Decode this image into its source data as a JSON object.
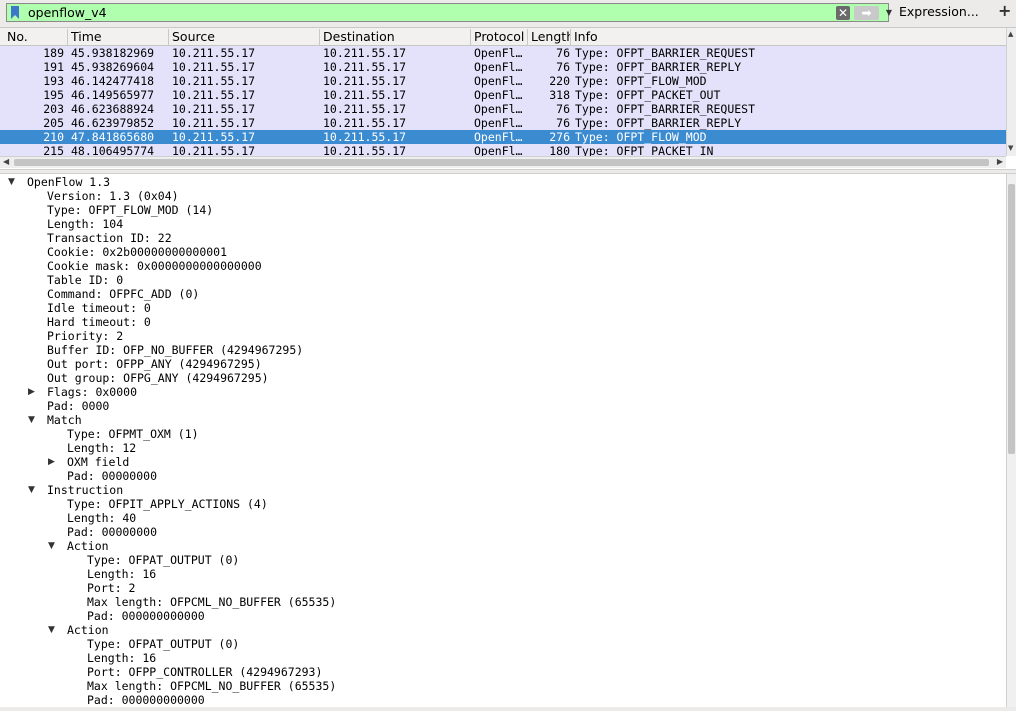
{
  "filter": {
    "text": "openflow_v4",
    "expression_label": "Expression...",
    "plus_label": "+"
  },
  "packet_list": {
    "columns": [
      "No.",
      "Time",
      "Source",
      "Destination",
      "Protocol",
      "Length",
      "Info"
    ],
    "rows": [
      {
        "no": "189",
        "time": "45.938182969",
        "src": "10.211.55.17",
        "dst": "10.211.55.17",
        "proto": "OpenFl…",
        "len": "76",
        "info": "Type: OFPT_BARRIER_REQUEST"
      },
      {
        "no": "191",
        "time": "45.938269604",
        "src": "10.211.55.17",
        "dst": "10.211.55.17",
        "proto": "OpenFl…",
        "len": "76",
        "info": "Type: OFPT_BARRIER_REPLY"
      },
      {
        "no": "193",
        "time": "46.142477418",
        "src": "10.211.55.17",
        "dst": "10.211.55.17",
        "proto": "OpenFl…",
        "len": "220",
        "info": "Type: OFPT_FLOW_MOD"
      },
      {
        "no": "195",
        "time": "46.149565977",
        "src": "10.211.55.17",
        "dst": "10.211.55.17",
        "proto": "OpenFl…",
        "len": "318",
        "info": "Type: OFPT_PACKET_OUT"
      },
      {
        "no": "203",
        "time": "46.623688924",
        "src": "10.211.55.17",
        "dst": "10.211.55.17",
        "proto": "OpenFl…",
        "len": "76",
        "info": "Type: OFPT_BARRIER_REQUEST"
      },
      {
        "no": "205",
        "time": "46.623979852",
        "src": "10.211.55.17",
        "dst": "10.211.55.17",
        "proto": "OpenFl…",
        "len": "76",
        "info": "Type: OFPT_BARRIER_REPLY"
      },
      {
        "no": "210",
        "time": "47.841865680",
        "src": "10.211.55.17",
        "dst": "10.211.55.17",
        "proto": "OpenFl…",
        "len": "276",
        "info": "Type: OFPT_FLOW_MOD",
        "selected": true
      },
      {
        "no": "215",
        "time": "48.106495774",
        "src": "10.211.55.17",
        "dst": "10.211.55.17",
        "proto": "OpenFl…",
        "len": "180",
        "info": "Type: OFPT_PACKET_IN"
      }
    ]
  },
  "details": [
    {
      "text": "OpenFlow 1.3",
      "depth": 0,
      "expander": "open"
    },
    {
      "text": "Version: 1.3 (0x04)",
      "depth": 1
    },
    {
      "text": "Type: OFPT_FLOW_MOD (14)",
      "depth": 1
    },
    {
      "text": "Length: 104",
      "depth": 1
    },
    {
      "text": "Transaction ID: 22",
      "depth": 1
    },
    {
      "text": "Cookie: 0x2b00000000000001",
      "depth": 1
    },
    {
      "text": "Cookie mask: 0x0000000000000000",
      "depth": 1
    },
    {
      "text": "Table ID: 0",
      "depth": 1
    },
    {
      "text": "Command: OFPFC_ADD (0)",
      "depth": 1
    },
    {
      "text": "Idle timeout: 0",
      "depth": 1
    },
    {
      "text": "Hard timeout: 0",
      "depth": 1
    },
    {
      "text": "Priority: 2",
      "depth": 1
    },
    {
      "text": "Buffer ID: OFP_NO_BUFFER (4294967295)",
      "depth": 1
    },
    {
      "text": "Out port: OFPP_ANY (4294967295)",
      "depth": 1
    },
    {
      "text": "Out group: OFPG_ANY (4294967295)",
      "depth": 1
    },
    {
      "text": "Flags: 0x0000",
      "depth": 1,
      "expander": "closed"
    },
    {
      "text": "Pad: 0000",
      "depth": 1
    },
    {
      "text": "Match",
      "depth": 1,
      "expander": "open"
    },
    {
      "text": "Type: OFPMT_OXM (1)",
      "depth": 2
    },
    {
      "text": "Length: 12",
      "depth": 2
    },
    {
      "text": "OXM field",
      "depth": 2,
      "expander": "closed"
    },
    {
      "text": "Pad: 00000000",
      "depth": 2
    },
    {
      "text": "Instruction",
      "depth": 1,
      "expander": "open"
    },
    {
      "text": "Type: OFPIT_APPLY_ACTIONS (4)",
      "depth": 2
    },
    {
      "text": "Length: 40",
      "depth": 2
    },
    {
      "text": "Pad: 00000000",
      "depth": 2
    },
    {
      "text": "Action",
      "depth": 2,
      "expander": "open"
    },
    {
      "text": "Type: OFPAT_OUTPUT (0)",
      "depth": 3
    },
    {
      "text": "Length: 16",
      "depth": 3
    },
    {
      "text": "Port: 2",
      "depth": 3
    },
    {
      "text": "Max length: OFPCML_NO_BUFFER (65535)",
      "depth": 3
    },
    {
      "text": "Pad: 000000000000",
      "depth": 3
    },
    {
      "text": "Action",
      "depth": 2,
      "expander": "open"
    },
    {
      "text": "Type: OFPAT_OUTPUT (0)",
      "depth": 3
    },
    {
      "text": "Length: 16",
      "depth": 3
    },
    {
      "text": "Port: OFPP_CONTROLLER (4294967293)",
      "depth": 3
    },
    {
      "text": "Max length: OFPCML_NO_BUFFER (65535)",
      "depth": 3
    },
    {
      "text": "Pad: 000000000000",
      "depth": 3
    }
  ],
  "icons": {
    "bookmark": "bookmark-icon",
    "clear": "clear-icon",
    "apply": "apply-arrow-icon",
    "dropdown": "chevron-down-icon",
    "expander_open": "triangle-down-icon",
    "expander_closed": "triangle-right-icon"
  },
  "colors": {
    "filter_valid": "#afffaf",
    "row_background": "#e4e2fa",
    "row_selected": "#3b8bd0"
  }
}
